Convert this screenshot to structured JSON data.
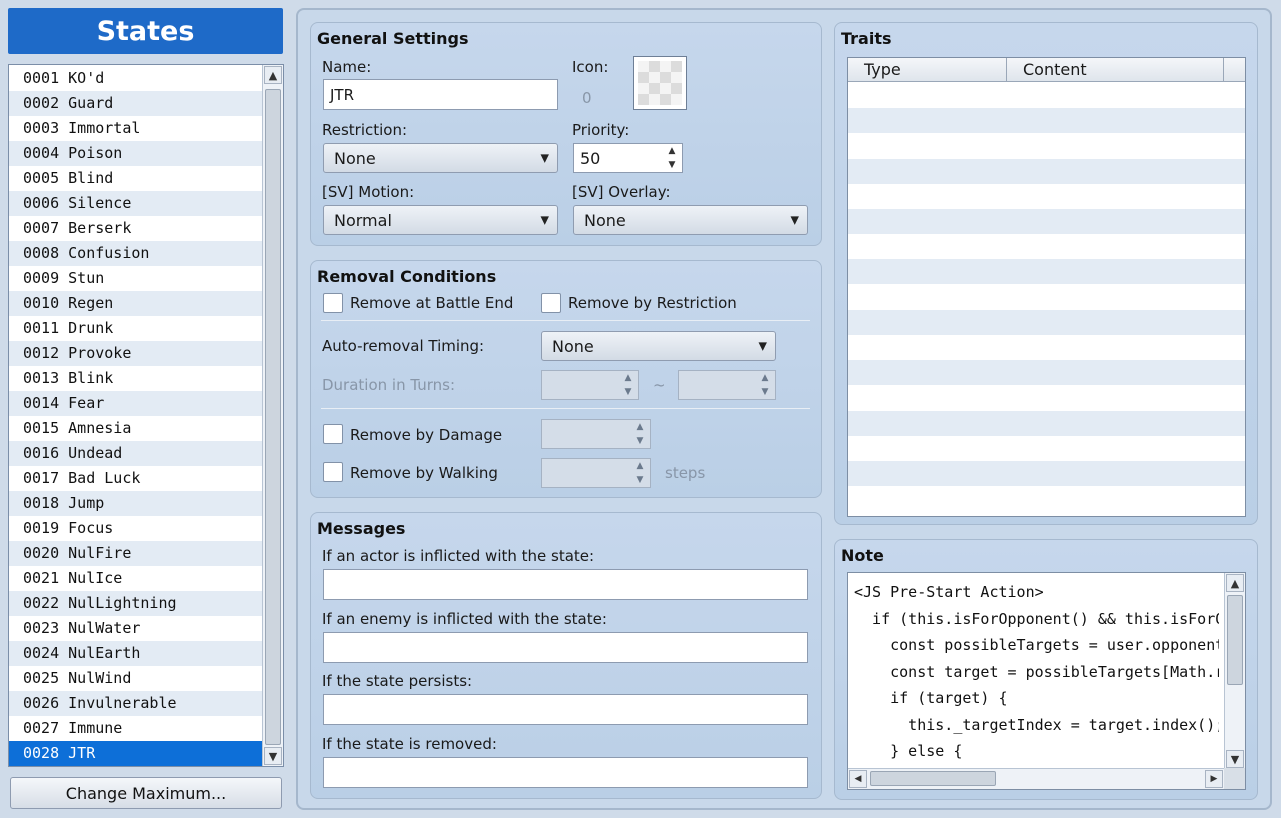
{
  "sidebar": {
    "title": "States",
    "items": [
      {
        "label": "0001 KO'd"
      },
      {
        "label": "0002 Guard"
      },
      {
        "label": "0003 Immortal"
      },
      {
        "label": "0004 Poison"
      },
      {
        "label": "0005 Blind"
      },
      {
        "label": "0006 Silence"
      },
      {
        "label": "0007 Berserk"
      },
      {
        "label": "0008 Confusion"
      },
      {
        "label": "0009 Stun"
      },
      {
        "label": "0010 Regen"
      },
      {
        "label": "0011 Drunk"
      },
      {
        "label": "0012 Provoke"
      },
      {
        "label": "0013 Blink"
      },
      {
        "label": "0014 Fear"
      },
      {
        "label": "0015 Amnesia"
      },
      {
        "label": "0016 Undead"
      },
      {
        "label": "0017 Bad Luck"
      },
      {
        "label": "0018 Jump"
      },
      {
        "label": "0019 Focus"
      },
      {
        "label": "0020 NulFire"
      },
      {
        "label": "0021 NulIce"
      },
      {
        "label": "0022 NulLightning"
      },
      {
        "label": "0023 NulWater"
      },
      {
        "label": "0024 NulEarth"
      },
      {
        "label": "0025 NulWind"
      },
      {
        "label": "0026 Invulnerable"
      },
      {
        "label": "0027 Immune"
      },
      {
        "label": "0028 JTR"
      }
    ],
    "selected_index": 27,
    "change_max_label": "Change Maximum..."
  },
  "general": {
    "title": "General Settings",
    "name_label": "Name:",
    "name_value": "JTR",
    "icon_label": "Icon:",
    "icon_index": "0",
    "restriction_label": "Restriction:",
    "restriction_value": "None",
    "priority_label": "Priority:",
    "priority_value": "50",
    "motion_label": "[SV] Motion:",
    "motion_value": "Normal",
    "overlay_label": "[SV] Overlay:",
    "overlay_value": "None"
  },
  "removal": {
    "title": "Removal Conditions",
    "battle_end_label": "Remove at Battle End",
    "restriction_label": "Remove by Restriction",
    "timing_label": "Auto-removal Timing:",
    "timing_value": "None",
    "duration_label": "Duration in Turns:",
    "tilde": "~",
    "damage_label": "Remove by Damage",
    "walking_label": "Remove by Walking",
    "steps_label": "steps"
  },
  "messages": {
    "title": "Messages",
    "actor_label": "If an actor is inflicted with the state:",
    "enemy_label": "If an enemy is inflicted with the state:",
    "persists_label": "If the state persists:",
    "removed_label": "If the state is removed:"
  },
  "traits": {
    "title": "Traits",
    "col_type": "Type",
    "col_content": "Content"
  },
  "note": {
    "title": "Note",
    "text": "<JS Pre-Start Action>\n  if (this.isForOpponent() && this.isForOr\n    const possibleTargets = user.opponents\n    const target = possibleTargets[Math.ra\n    if (target) {\n      this._targetIndex = target.index();\n    } else {"
  }
}
